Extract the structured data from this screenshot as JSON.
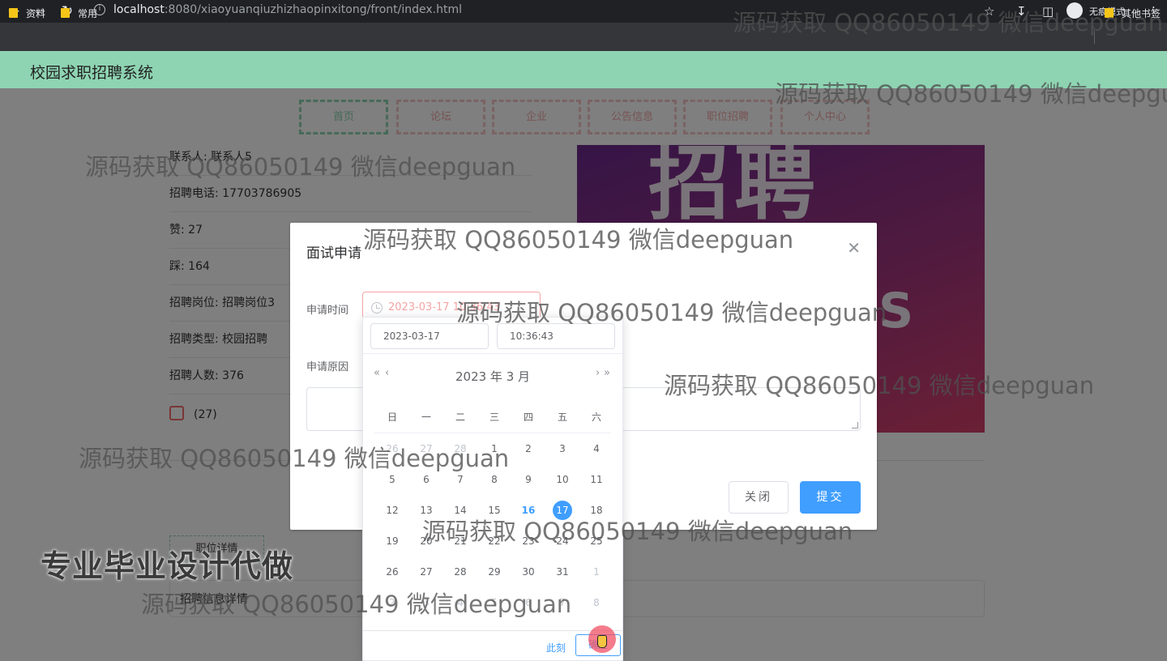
{
  "browser": {
    "url_host": "localhost",
    "url_path": ":8080/xiaoyuanqiuzhizhaopinxitong/front/index.html",
    "incognito_label": "无痕模式",
    "bookmarks": [
      "资料",
      "常用"
    ],
    "other_bookmarks": "其他书签"
  },
  "site": {
    "title": "校园求职招聘系统",
    "menu": [
      {
        "label": "首页",
        "active": true
      },
      {
        "label": "论坛"
      },
      {
        "label": "企业"
      },
      {
        "label": "公告信息"
      },
      {
        "label": "职位招聘"
      },
      {
        "label": "个人中心"
      }
    ]
  },
  "job": {
    "rows": [
      "联系人: 联系人5",
      "招聘电话: 17703786905",
      "赞: 27",
      "踩: 164",
      "招聘岗位: 招聘岗位3",
      "招聘类型: 校园招聘",
      "招聘人数: 376"
    ],
    "like_count": "(27)",
    "banner_text": "招聘",
    "banner_letter": "S",
    "section_tag": "职位详情",
    "detail_label": "招聘信息详情"
  },
  "dialog": {
    "title": "面试申请",
    "time_label": "申请时间",
    "time_value": "2023-03-17 10:36:43",
    "reason_label": "申请原因",
    "cancel_label": "关闭",
    "submit_label": "提交"
  },
  "picker": {
    "date_value": "2023-03-17",
    "time_value": "10:36:43",
    "year_month": "2023 年  3 月",
    "weekdays": [
      "日",
      "一",
      "二",
      "三",
      "四",
      "五",
      "六"
    ],
    "weeks": [
      [
        "26",
        "27",
        "28",
        "1",
        "2",
        "3",
        "4"
      ],
      [
        "5",
        "6",
        "7",
        "8",
        "9",
        "10",
        "11"
      ],
      [
        "12",
        "13",
        "14",
        "15",
        "16",
        "17",
        "18"
      ],
      [
        "19",
        "20",
        "21",
        "22",
        "23",
        "24",
        "25"
      ],
      [
        "26",
        "27",
        "28",
        "29",
        "30",
        "31",
        "1"
      ],
      [
        "2",
        "3",
        "4",
        "5",
        "6",
        "7",
        "8"
      ]
    ],
    "now_label": "此刻",
    "ok_label": "确定"
  },
  "watermarks": {
    "text": "源码获取 QQ86050149 微信deepguan",
    "banner": "专业毕业设计代做"
  },
  "colors": {
    "header_green": "#8ed4b2",
    "menu_pink": "#f5c6c6",
    "primary_blue": "#409eff"
  }
}
